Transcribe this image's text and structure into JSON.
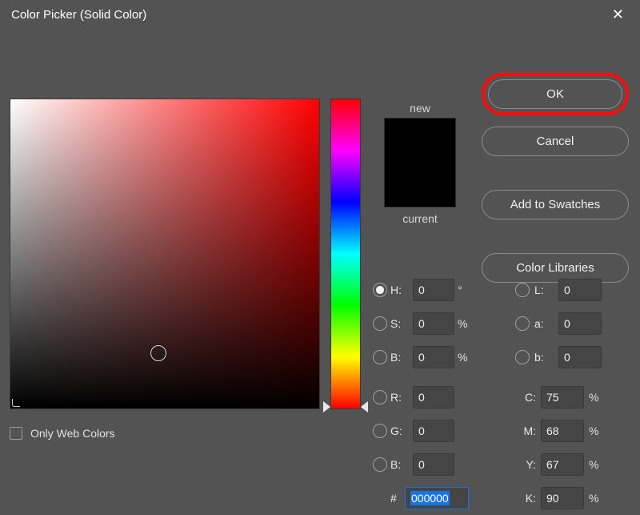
{
  "title": "Color Picker (Solid Color)",
  "buttons": {
    "ok": "OK",
    "cancel": "Cancel",
    "add_swatches": "Add to Swatches",
    "color_libraries": "Color Libraries"
  },
  "swatch": {
    "new_label": "new",
    "current_label": "current",
    "new_color": "#000000",
    "current_color": "#000000"
  },
  "fields": {
    "H": {
      "label": "H:",
      "value": "0",
      "unit": "°"
    },
    "S": {
      "label": "S:",
      "value": "0",
      "unit": "%"
    },
    "Bv": {
      "label": "B:",
      "value": "0",
      "unit": "%"
    },
    "R": {
      "label": "R:",
      "value": "0"
    },
    "G": {
      "label": "G:",
      "value": "0"
    },
    "Bc": {
      "label": "B:",
      "value": "0"
    },
    "L": {
      "label": "L:",
      "value": "0"
    },
    "a": {
      "label": "a:",
      "value": "0"
    },
    "b": {
      "label": "b:",
      "value": "0"
    },
    "C": {
      "label": "C:",
      "value": "75",
      "unit": "%"
    },
    "M": {
      "label": "M:",
      "value": "68",
      "unit": "%"
    },
    "Y": {
      "label": "Y:",
      "value": "67",
      "unit": "%"
    },
    "K": {
      "label": "K:",
      "value": "90",
      "unit": "%"
    },
    "hex_label": "#",
    "hex_value": "000000"
  },
  "selected_radio": "H",
  "hue_slider_position_pct": 99,
  "sb_indicator": {
    "left_pct": 48,
    "top_pct": 82
  },
  "only_web_colors": {
    "label": "Only Web Colors",
    "checked": false
  }
}
